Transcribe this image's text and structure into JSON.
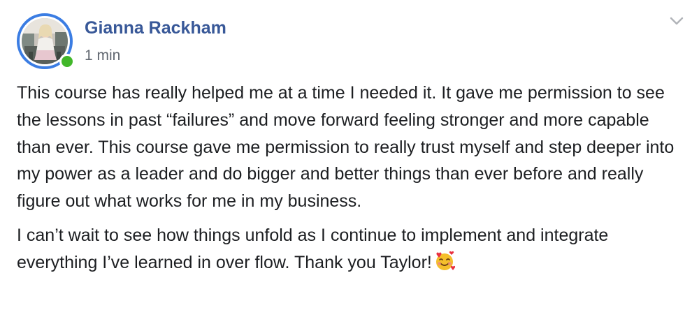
{
  "post": {
    "author": "Gianna Rackham",
    "timestamp": "1 min",
    "online": true,
    "options_icon": "chevron-down-icon",
    "paragraphs": [
      "This course has really helped me at a time I needed it. It gave me permission to see the lessons in past “failures” and move forward feeling stronger and more capable than ever. This course gave me permission to really trust myself and step deeper into my power as a leader and do bigger and better things than ever before and really figure out what works for me in my business.",
      "I can’t wait to see how things unfold as I continue to implement and integrate everything I’ve learned in over flow. Thank you Taylor!"
    ],
    "trailing_emoji": "smiling-face-with-hearts-emoji"
  },
  "colors": {
    "author": "#385898",
    "timestamp": "#616770",
    "text": "#1c1e21",
    "avatar_ring": "#3b7de3",
    "online_dot": "#42b72a",
    "chevron": "#b0b3b8"
  }
}
